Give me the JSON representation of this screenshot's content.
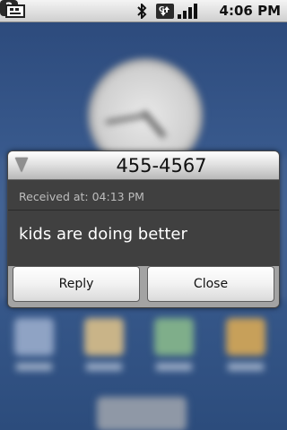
{
  "status_bar": {
    "time": "4:06 PM",
    "icons": [
      "keyboard-icon",
      "bluetooth-icon",
      "data-transfer-icon",
      "signal-icon",
      "help-icon"
    ],
    "help_glyph": "?"
  },
  "dialog": {
    "title": "455-4567",
    "received_label": "Received at:",
    "received_time": "04:13 PM",
    "message": "kids are doing better",
    "reply_label": "Reply",
    "close_label": "Close"
  },
  "colors": {
    "dialog_body": "#404040",
    "title_bar": "#e2e2e2",
    "button_face": "#f2f2f2"
  }
}
